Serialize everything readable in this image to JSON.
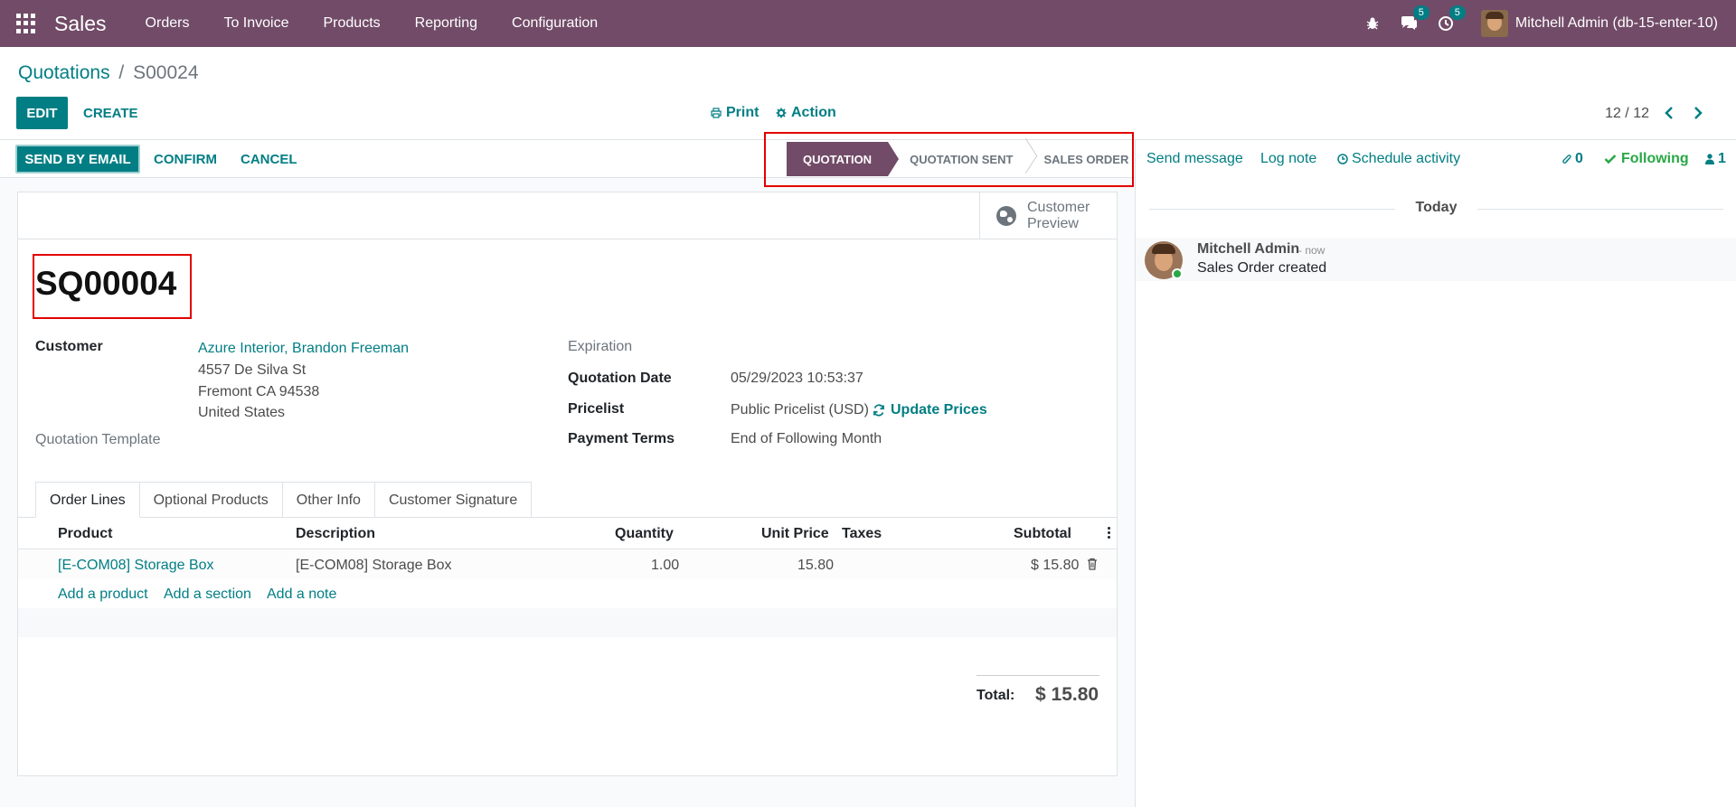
{
  "navbar": {
    "brand": "Sales",
    "menu": [
      "Orders",
      "To Invoice",
      "Products",
      "Reporting",
      "Configuration"
    ],
    "messages_badge": "5",
    "activities_badge": "5",
    "user": "Mitchell Admin (db-15-enter-10)",
    "icons": [
      "apps-icon",
      "bug-icon",
      "chat-icon",
      "clock-icon",
      "user-avatar"
    ]
  },
  "breadcrumb": {
    "parent": "Quotations",
    "separator": "/",
    "current": "S00024"
  },
  "toolbar": {
    "edit": "EDIT",
    "create": "CREATE",
    "print": "Print",
    "action": "Action",
    "pager": "12 / 12"
  },
  "statusbar": {
    "send_email": "SEND BY EMAIL",
    "confirm": "CONFIRM",
    "cancel": "CANCEL",
    "stages": [
      "QUOTATION",
      "QUOTATION SENT",
      "SALES ORDER"
    ],
    "active_stage": "QUOTATION"
  },
  "form": {
    "customer_preview": "Customer Preview",
    "name": "SQ00004",
    "customer_label": "Customer",
    "customer_name": "Azure Interior, Brandon Freeman",
    "address_line1": "4557 De Silva St",
    "address_line2": "Fremont CA 94538",
    "address_line3": "United States",
    "template_label": "Quotation Template",
    "expiration_label": "Expiration",
    "quotation_date_label": "Quotation Date",
    "quotation_date": "05/29/2023 10:53:37",
    "pricelist_label": "Pricelist",
    "pricelist": "Public Pricelist (USD)",
    "update_prices": "Update Prices",
    "payment_terms_label": "Payment Terms",
    "payment_terms": "End of Following Month"
  },
  "tabs": [
    "Order Lines",
    "Optional Products",
    "Other Info",
    "Customer Signature"
  ],
  "order_lines": {
    "columns": [
      "Product",
      "Description",
      "Quantity",
      "Unit Price",
      "Taxes",
      "Subtotal"
    ],
    "rows": [
      {
        "product": "[E-COM08] Storage Box",
        "description": "[E-COM08] Storage Box",
        "quantity": "1.00",
        "unit_price": "15.80",
        "taxes": "",
        "subtotal": "$ 15.80"
      }
    ],
    "add_product": "Add a product",
    "add_section": "Add a section",
    "add_note": "Add a note",
    "total_label": "Total:",
    "total_value": "$ 15.80"
  },
  "chatter": {
    "send_message": "Send message",
    "log_note": "Log note",
    "schedule_activity": "Schedule activity",
    "attachments": "0",
    "following": "Following",
    "followers": "1",
    "today": "Today",
    "message": {
      "author": "Mitchell Admin",
      "date": "- now",
      "body": "Sales Order created"
    }
  },
  "colors": {
    "brand": "#714b67",
    "accent": "#017e84",
    "highlight": "#e30000",
    "following": "#28a745"
  }
}
